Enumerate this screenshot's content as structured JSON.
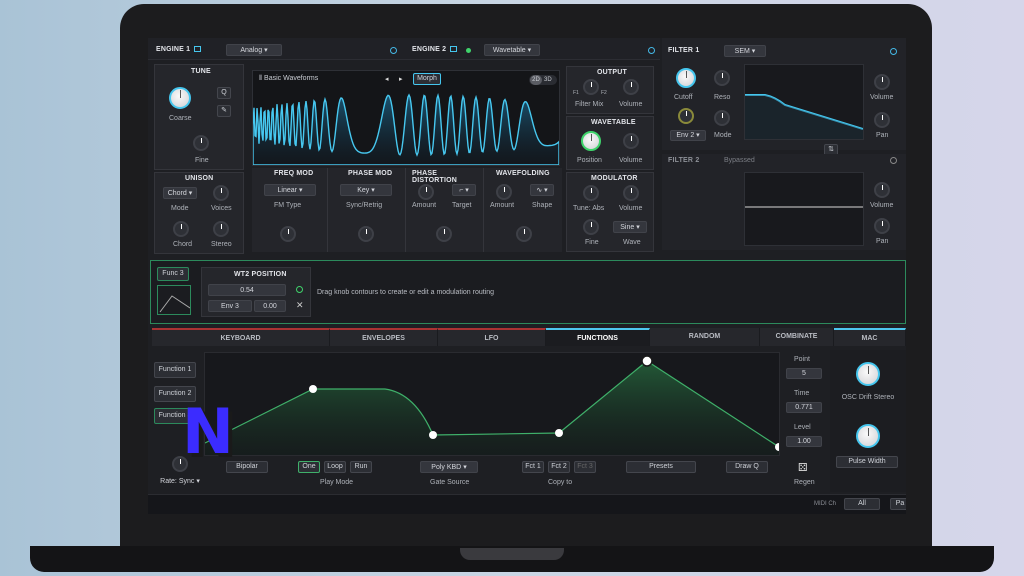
{
  "engine1": {
    "title": "ENGINE 1",
    "type": "Analog"
  },
  "engine2": {
    "title": "ENGINE 2",
    "type": "Wavetable"
  },
  "filter1": {
    "title": "FILTER 1",
    "type": "SEM",
    "cutoff": "Cutoff",
    "reso": "Reso",
    "volume": "Volume",
    "pan": "Pan",
    "env": "Env 2",
    "mode": "Mode"
  },
  "filter2": {
    "title": "FILTER 2",
    "status": "Bypassed",
    "volume": "Volume",
    "pan": "Pan"
  },
  "tune": {
    "title": "TUNE",
    "coarse": "Coarse",
    "fine": "Fine",
    "q": "Q"
  },
  "unison": {
    "title": "UNISON",
    "mode_value": "Chord",
    "mode": "Mode",
    "voices": "Voices",
    "chord": "Chord",
    "stereo": "Stereo"
  },
  "wavetable_display": {
    "name": "Basic Waveforms",
    "morph": "Morph",
    "view2d": "2D",
    "view3d": "3D"
  },
  "output": {
    "title": "OUTPUT",
    "filter_mix": "Filter Mix",
    "volume": "Volume",
    "f1": "F1",
    "f2": "F2"
  },
  "wavetable": {
    "title": "WAVETABLE",
    "position": "Position",
    "volume": "Volume"
  },
  "modulator": {
    "title": "MODULATOR",
    "tune": "Tune: Abs",
    "volume": "Volume",
    "fine": "Fine",
    "wave_value": "Sine",
    "wave": "Wave"
  },
  "freq_mod": {
    "title": "FREQ MOD",
    "type_value": "Linear",
    "type": "FM Type"
  },
  "phase_mod": {
    "title": "PHASE MOD",
    "key": "Key",
    "sync": "Sync/Retrig"
  },
  "phase_distortion": {
    "title": "PHASE DISTORTION",
    "amount": "Amount",
    "target": "Target"
  },
  "wavefolding": {
    "title": "WAVEFOLDING",
    "amount": "Amount",
    "shape": "Shape"
  },
  "mod_routing": {
    "func": "Func 3",
    "title": "WT2 POSITION",
    "value": "0.54",
    "source": "Env 3",
    "amount": "0.00",
    "hint": "Drag knob contours to create or edit a modulation routing"
  },
  "tabs": [
    "KEYBOARD",
    "ENVELOPES",
    "LFO",
    "FUNCTIONS",
    "RANDOM",
    "COMBINATE",
    "MAC"
  ],
  "functions": [
    "Function 1",
    "Function 2",
    "Function 3"
  ],
  "point": {
    "label": "Point",
    "value": "5",
    "time_label": "Time",
    "time": "0.771",
    "level_label": "Level",
    "level": "1.00"
  },
  "bottom": {
    "rate": "Rate: Sync",
    "bipolar": "Bipolar",
    "one": "One",
    "loop": "Loop",
    "run": "Run",
    "play_mode": "Play Mode",
    "gate_value": "Poly KBD",
    "gate_source": "Gate Source",
    "fct1": "Fct 1",
    "fct2": "Fct 2",
    "fct3": "Fct 3",
    "copy_to": "Copy to",
    "presets": "Presets",
    "draw": "Draw Q",
    "regen": "Regen"
  },
  "macros": {
    "m1": "OSC Drift Stereo",
    "m2": "Pulse Width"
  },
  "status": {
    "midi": "MIDI Ch",
    "all": "All",
    "pa": "Pa"
  },
  "overlay_letter": "N",
  "colors": {
    "accent": "#45c6ee",
    "green": "#2e8f4e",
    "overlay": "#3b2cff"
  }
}
